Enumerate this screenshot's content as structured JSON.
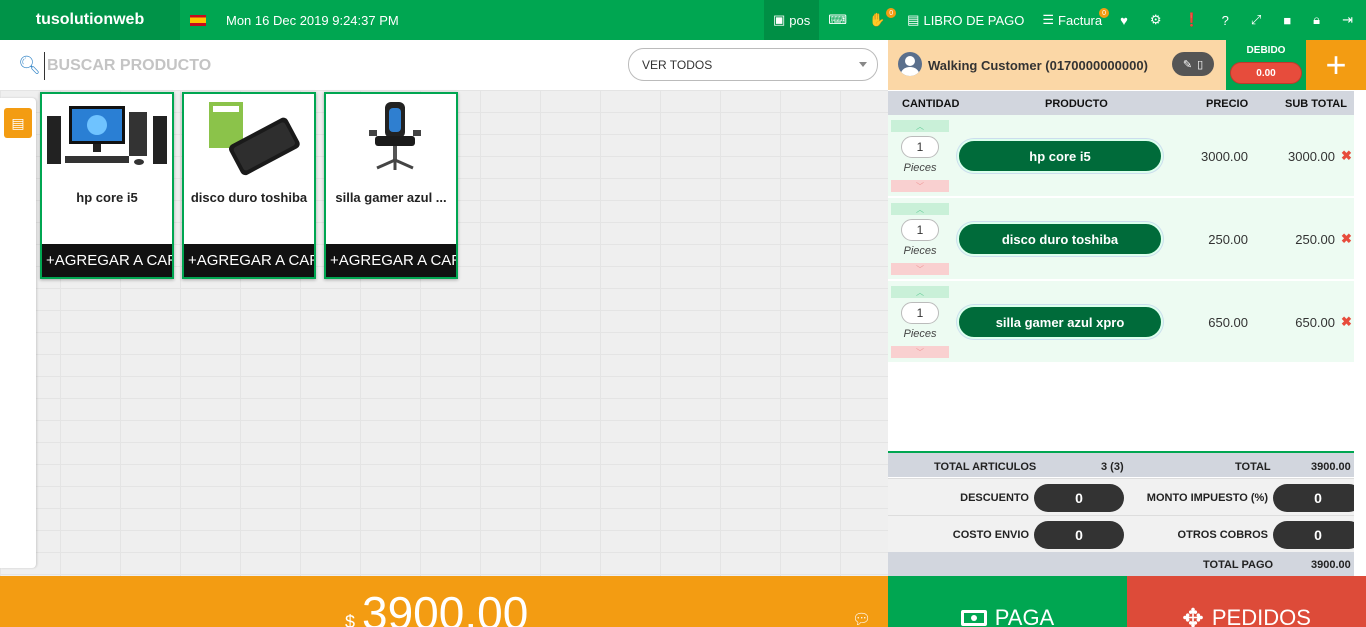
{
  "topbar": {
    "brand": "tusolutionweb",
    "datetime": "Mon 16 Dec 2019 9:24:37 PM",
    "nav": [
      {
        "icon": "pos-icon",
        "label": "pos"
      },
      {
        "icon": "keyboard-icon",
        "label": ""
      },
      {
        "icon": "hand-icon",
        "label": "",
        "badge": "0"
      },
      {
        "icon": "book-icon",
        "label": "LIBRO DE PAGO"
      },
      {
        "icon": "list-icon",
        "label": "Factura",
        "badge": "0"
      },
      {
        "icon": "heart-icon",
        "label": ""
      },
      {
        "icon": "gear-icon",
        "label": ""
      },
      {
        "icon": "alert-icon",
        "label": ""
      },
      {
        "icon": "help-icon",
        "label": ""
      },
      {
        "icon": "expand-icon",
        "label": ""
      },
      {
        "icon": "square-icon",
        "label": ""
      },
      {
        "icon": "lock-icon",
        "label": ""
      },
      {
        "icon": "logout-icon",
        "label": ""
      }
    ]
  },
  "search": {
    "placeholder": "BUSCAR PRODUCTO",
    "filter_value": "VER TODOS"
  },
  "products": [
    {
      "name": "hp core i5",
      "add_label": "+AGREGAR A CARRITO"
    },
    {
      "name": "disco duro toshiba",
      "add_label": "+AGREGAR A CARRITO"
    },
    {
      "name": "silla gamer azul ...",
      "add_label": "+AGREGAR A CARRITO"
    }
  ],
  "customer": {
    "name": "Walking Customer (0170000000000)",
    "debido_label": "DEBIDO",
    "debido_value": "0.00"
  },
  "cart": {
    "headers": {
      "cantidad": "CANTIDAD",
      "producto": "PRODUCTO",
      "precio": "PRECIO",
      "subtotal": "SUB TOTAL"
    },
    "items": [
      {
        "qty": "1",
        "unit": "Pieces",
        "name": "hp core i5",
        "price": "3000.00",
        "subtotal": "3000.00"
      },
      {
        "qty": "1",
        "unit": "Pieces",
        "name": "disco duro toshiba",
        "price": "250.00",
        "subtotal": "250.00"
      },
      {
        "qty": "1",
        "unit": "Pieces",
        "name": "silla gamer azul xpro",
        "price": "650.00",
        "subtotal": "650.00"
      }
    ]
  },
  "summary": {
    "total_articulos_label": "TOTAL ARTICULOS",
    "total_articulos_value": "3 (3)",
    "total_label": "TOTAL",
    "total_value": "3900.00",
    "descuento_label": "DESCUENTO",
    "descuento_value": "0",
    "impuesto_label": "MONTO IMPUESTO (%)",
    "impuesto_value": "0",
    "envio_label": "COSTO ENVIO",
    "envio_value": "0",
    "otros_label": "OTROS COBROS",
    "otros_value": "0",
    "total_pago_label": "TOTAL PAGO",
    "total_pago_value": "3900.00"
  },
  "footer": {
    "currency": "$",
    "amount": "3900.00",
    "pay_label": "PAGA",
    "orders_label": "PEDIDOS"
  }
}
